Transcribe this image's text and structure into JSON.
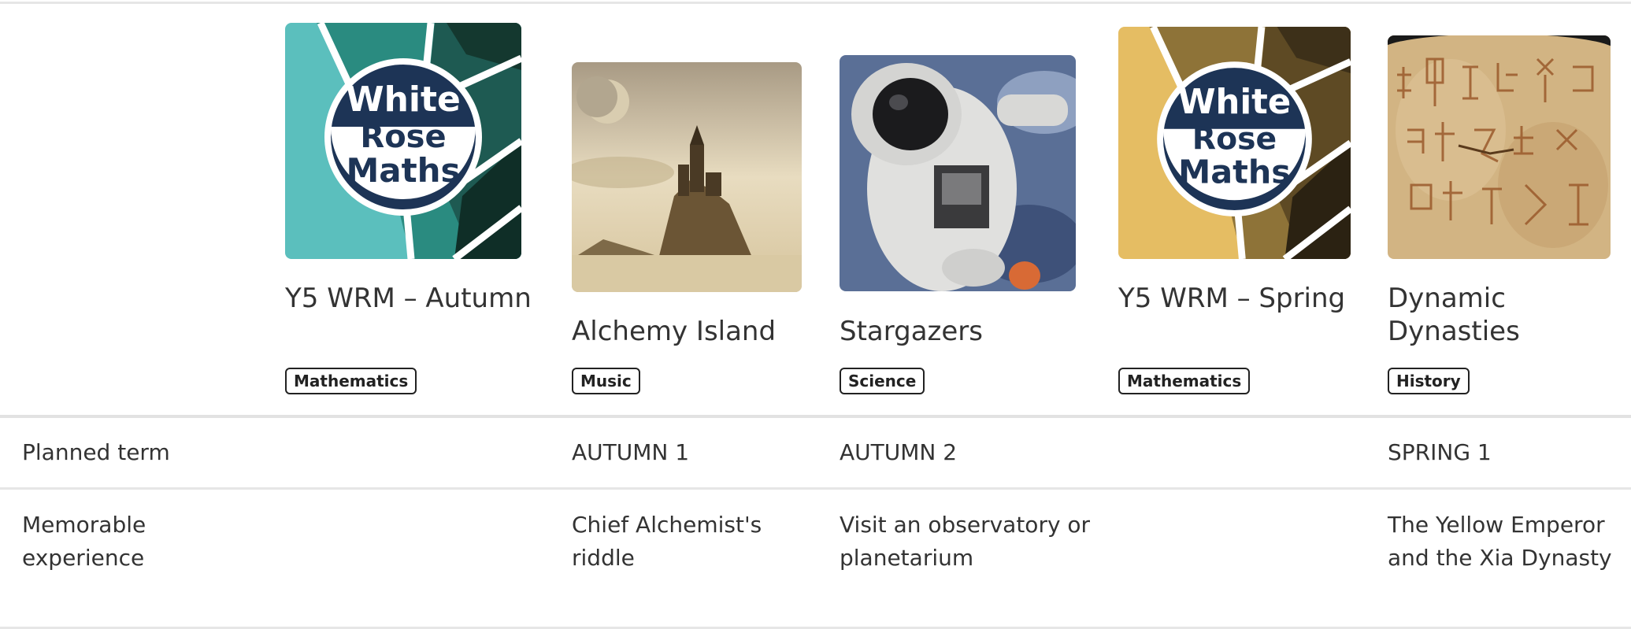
{
  "columns": [
    {
      "title": "Y5 WRM – Autumn",
      "subject": "Mathematics",
      "image": "white-rose-maths-logo-teal",
      "logo_text": [
        "White",
        "Rose",
        "Maths"
      ],
      "planned_term": "",
      "memorable_experience": ""
    },
    {
      "title": "Alchemy Island",
      "subject": "Music",
      "image": "castle-on-island-photo",
      "planned_term": "AUTUMN 1",
      "memorable_experience": "Chief Alchemist's riddle"
    },
    {
      "title": "Stargazers",
      "subject": "Science",
      "image": "astronaut-photo",
      "planned_term": "AUTUMN 2",
      "memorable_experience": "Visit an observatory or planetarium"
    },
    {
      "title": "Y5 WRM – Spring",
      "subject": "Mathematics",
      "image": "white-rose-maths-logo-gold",
      "logo_text": [
        "White",
        "Rose",
        "Maths"
      ],
      "planned_term": "",
      "memorable_experience": ""
    },
    {
      "title": "Dynamic Dynasties",
      "subject": "History",
      "image": "ancient-inscription-photo",
      "planned_term": "SPRING 1",
      "memorable_experience": "The Yellow Emperor and the Xia Dynasty"
    }
  ],
  "rows": {
    "planned_term_label": "Planned term",
    "memorable_experience_label": "Memorable experience"
  },
  "colors": {
    "wrm_teal": "#5bbfbd",
    "wrm_teal_dark": "#1e5a52",
    "wrm_gold": "#e5bd63",
    "wrm_gold_dark": "#5e4a24",
    "wrm_navy": "#1d3456",
    "badge_border": "#222222",
    "divider": "#e4e4e4"
  }
}
